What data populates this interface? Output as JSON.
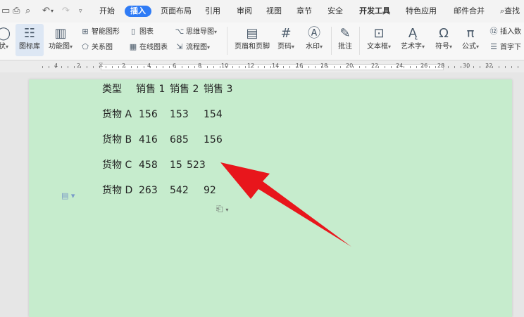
{
  "menu": {
    "items": [
      "开始",
      "插入",
      "页面布局",
      "引用",
      "审阅",
      "视图",
      "章节",
      "安全",
      "开发工具",
      "特色应用",
      "邮件合并"
    ],
    "active_index": 1,
    "search_label": "查找"
  },
  "ribbon": {
    "shape_label": "状",
    "icon_library": "图标库",
    "function_chart": "功能图",
    "smart_shape": "智能图形",
    "chart": "图表",
    "mind_map": "思维导图",
    "relation_chart": "关系图",
    "online_chart": "在线图表",
    "flowchart": "流程图",
    "header_footer": "页眉和页脚",
    "page_number": "页码",
    "watermark": "水印",
    "comment": "批注",
    "text_box": "文本框",
    "art_text": "艺术字",
    "symbol": "符号",
    "formula": "公式",
    "insert_number": "插入数",
    "drop_cap": "首字下"
  },
  "ruler": {
    "labels": [
      "4",
      "2",
      "2",
      "4",
      "6",
      "8",
      "10",
      "12",
      "14",
      "16",
      "18",
      "20",
      "22",
      "24",
      "26",
      "28",
      "30",
      "32",
      "34"
    ]
  },
  "document": {
    "rows": [
      [
        "类型",
        "销售 1",
        "销售 2",
        "销售 3"
      ],
      [
        "货物 A",
        "156",
        "153",
        "154"
      ],
      [
        "货物 B",
        "416",
        "685",
        "156"
      ],
      [
        "货物 C",
        "458",
        "15",
        "523"
      ],
      [
        "货物 D",
        "263",
        "542",
        "92"
      ]
    ]
  },
  "colors": {
    "page_background": "#c6eccd",
    "active_tab": "#2f7bf5",
    "arrow": "#e8161c"
  }
}
